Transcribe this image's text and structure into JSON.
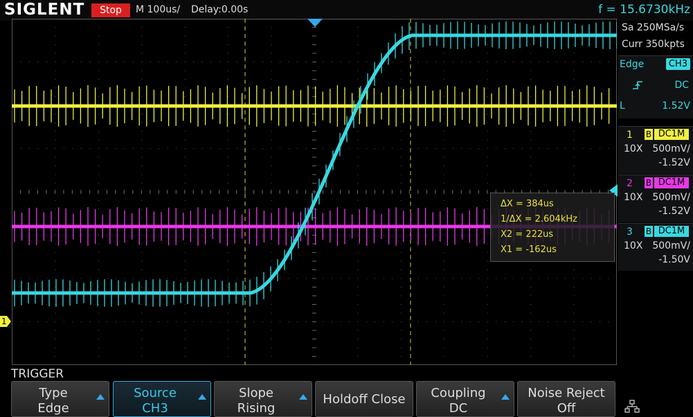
{
  "header": {
    "brand": "SIGLENT",
    "run_state": "Stop",
    "timebase": "M 100us/",
    "delay": "Delay:0.00s",
    "frequency": "f = 15.6730kHz"
  },
  "acquisition": {
    "sample_rate": "Sa 250MSa/s",
    "memory_depth": "Curr 350kpts"
  },
  "trigger_status": {
    "type": "Edge",
    "source": "CH3",
    "slope_icon": "rising-edge-icon",
    "coupling": "DC",
    "level_label": "L",
    "level": "1.52V"
  },
  "channels": [
    {
      "num": "1",
      "bw": "B",
      "coupling": "DC1M",
      "probe": "10X",
      "scale": "500mV/",
      "offset": "-1.52V",
      "color": "#f0f040"
    },
    {
      "num": "2",
      "bw": "B",
      "coupling": "DC1M",
      "probe": "10X",
      "scale": "500mV/",
      "offset": "-1.52V",
      "color": "#e838e8"
    },
    {
      "num": "3",
      "bw": "B",
      "coupling": "DC1M",
      "probe": "10X",
      "scale": "500mV/",
      "offset": "-1.50V",
      "color": "#38d8e0"
    }
  ],
  "cursor_measure": {
    "delta_x": "ΔX = 384us",
    "inv_delta_x": "1/ΔX = 2.604kHz",
    "x2": "X2 = 222us",
    "x1": "X1 = -162us"
  },
  "menu": {
    "title": "TRIGGER",
    "items": [
      {
        "line1": "Type",
        "line2": "Edge",
        "arrow": true
      },
      {
        "line1": "Source",
        "line2": "CH3",
        "arrow": true,
        "selected": true
      },
      {
        "line1": "Slope",
        "line2": "Rising",
        "arrow": true
      },
      {
        "single": "Holdoff Close"
      },
      {
        "line1": "Coupling",
        "line2": "DC",
        "arrow": true
      },
      {
        "line1": "Noise Reject",
        "line2": "Off",
        "arrow": false
      }
    ],
    "network_icon": "network-icon"
  },
  "marker_labels": {
    "ch1_ground": "1"
  },
  "colors": {
    "ch1": "#f0f040",
    "ch2": "#e838e8",
    "ch3": "#38d8e0",
    "cursor": "#e8e040",
    "stop": "#d92020"
  }
}
